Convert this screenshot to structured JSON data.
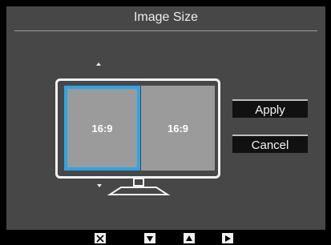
{
  "dialog": {
    "title": "Image Size"
  },
  "preview": {
    "left_label": "16:9",
    "right_label": "16:9",
    "selected": "left",
    "accent_color": "#2aa7e6"
  },
  "buttons": {
    "apply": "Apply",
    "cancel": "Cancel"
  },
  "footer": {
    "icons": [
      "close-icon",
      "arrow-down-icon",
      "arrow-up-icon",
      "arrow-right-icon"
    ]
  }
}
